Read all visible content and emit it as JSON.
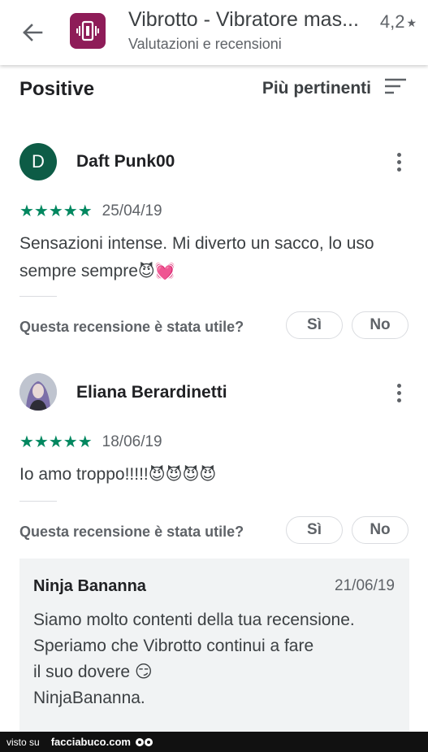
{
  "header": {
    "app_title": "Vibrotto - Vibratore mas...",
    "subtitle": "Valutazioni e recensioni",
    "rating": "4,2",
    "rating_star": "★",
    "app_color": "#8e1c58"
  },
  "filter": {
    "label": "Positive",
    "sort_label": "Più pertinenti"
  },
  "reviews": [
    {
      "avatar_letter": "D",
      "avatar_color": "#0d5c46",
      "author": "Daft Punk00",
      "stars": "★★★★★",
      "rating_value": 5,
      "date": "25/04/19",
      "text": "Sensazioni intense. Mi diverto un sacco, lo uso sempre sempre",
      "emoji": "😈💓",
      "helpful_question": "Questa recensione è stata utile?",
      "yes": "Sì",
      "no": "No"
    },
    {
      "avatar_icon": "profile-photo-icon",
      "author": "Eliana Berardinetti",
      "stars": "★★★★★",
      "rating_value": 5,
      "date": "18/06/19",
      "text": "Io amo troppo!!!!!",
      "emoji": "😈😈😈😈",
      "helpful_question": "Questa recensione è stata utile?",
      "yes": "Sì",
      "no": "No"
    }
  ],
  "reply": {
    "author": "Ninja Bananna",
    "date": "21/06/19",
    "text": "Siamo molto contenti della tua recensione.\nSperiamo che Vibrotto continui a fare\nil suo dovere 😏\nNinjaBananna."
  },
  "footer": {
    "prefix": "visto su",
    "brand": "facciabuco.com"
  }
}
